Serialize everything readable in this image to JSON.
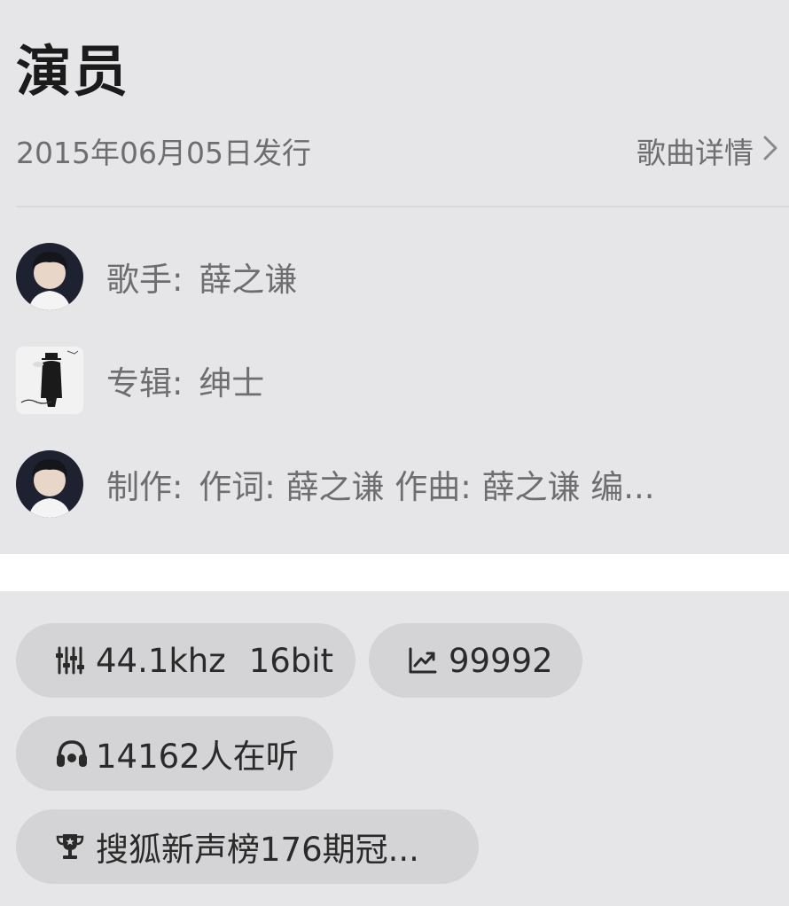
{
  "song": {
    "title": "演员",
    "release": "2015年06月05日发行",
    "details_label": "歌曲详情"
  },
  "info": {
    "singer": {
      "key": "歌手:",
      "value": "薛之谦"
    },
    "album": {
      "key": "专辑:",
      "value": "绅士"
    },
    "credits": {
      "key": "制作:",
      "value": "作词: 薛之谦  作曲: 薛之谦  编..."
    }
  },
  "tags": {
    "quality_rate": "44.1khz",
    "quality_bits": "16bit",
    "trend_count": "99992",
    "listeners": "14162人在听",
    "chart_award": "搜狐新声榜176期冠..."
  },
  "icons": {
    "details_arrow": "chevron-right-icon",
    "quality": "equalizer-icon",
    "trend": "trending-up-icon",
    "listeners": "headphones-icon",
    "award": "trophy-icon"
  }
}
